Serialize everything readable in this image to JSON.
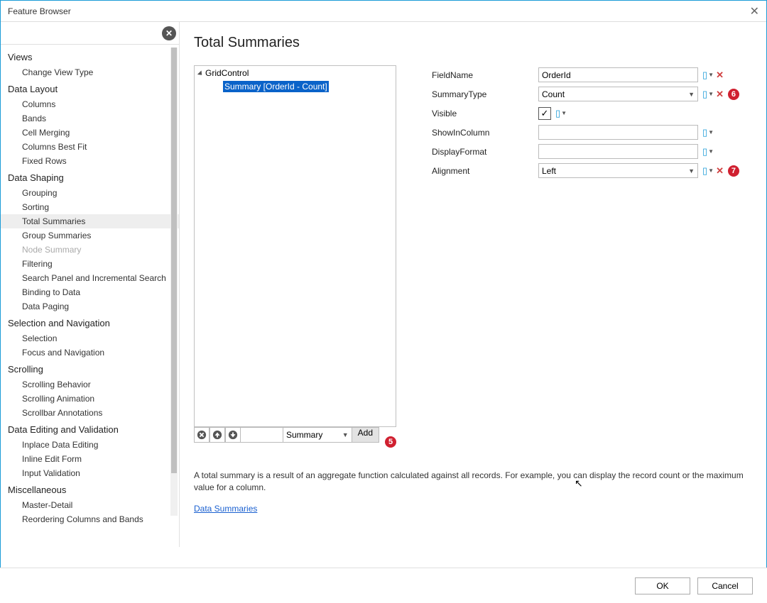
{
  "window": {
    "title": "Feature Browser"
  },
  "sidebar": {
    "categories": [
      {
        "label": "Views",
        "items": [
          {
            "label": "Change View Type"
          }
        ]
      },
      {
        "label": "Data Layout",
        "items": [
          {
            "label": "Columns"
          },
          {
            "label": "Bands"
          },
          {
            "label": "Cell Merging"
          },
          {
            "label": "Columns Best Fit"
          },
          {
            "label": "Fixed Rows"
          }
        ]
      },
      {
        "label": "Data Shaping",
        "items": [
          {
            "label": "Grouping"
          },
          {
            "label": "Sorting"
          },
          {
            "label": "Total Summaries",
            "selected": true
          },
          {
            "label": "Group Summaries"
          },
          {
            "label": "Node Summary",
            "disabled": true
          },
          {
            "label": "Filtering"
          },
          {
            "label": "Search Panel and Incremental Search"
          },
          {
            "label": "Binding to Data"
          },
          {
            "label": "Data Paging"
          }
        ]
      },
      {
        "label": "Selection and Navigation",
        "items": [
          {
            "label": "Selection"
          },
          {
            "label": "Focus and Navigation"
          }
        ]
      },
      {
        "label": "Scrolling",
        "items": [
          {
            "label": "Scrolling Behavior"
          },
          {
            "label": "Scrolling Animation"
          },
          {
            "label": "Scrollbar Annotations"
          }
        ]
      },
      {
        "label": "Data Editing and Validation",
        "items": [
          {
            "label": "Inplace Data Editing"
          },
          {
            "label": "Inline Edit Form"
          },
          {
            "label": "Input Validation"
          }
        ]
      },
      {
        "label": "Miscellaneous",
        "items": [
          {
            "label": "Master-Detail"
          },
          {
            "label": "Reordering Columns and Bands"
          }
        ]
      }
    ]
  },
  "page": {
    "title": "Total Summaries",
    "tree": {
      "root": "GridControl",
      "child": "Summary [OrderId - Count]"
    },
    "toolbar": {
      "type_label": "Summary",
      "add_label": "Add"
    },
    "description": "A total summary is a result of an aggregate function calculated against all records. For example, you can display the record count or the maximum value for a column.",
    "link": "Data Summaries"
  },
  "props": {
    "rows": [
      {
        "label": "FieldName",
        "kind": "text",
        "value": "OrderId",
        "has_x": true,
        "annot": ""
      },
      {
        "label": "SummaryType",
        "kind": "select",
        "value": "Count",
        "has_x": true,
        "annot": "6"
      },
      {
        "label": "Visible",
        "kind": "check",
        "value": "✓",
        "has_x": false,
        "annot": ""
      },
      {
        "label": "ShowInColumn",
        "kind": "text",
        "value": "",
        "has_x": false,
        "annot": ""
      },
      {
        "label": "DisplayFormat",
        "kind": "text",
        "value": "",
        "has_x": false,
        "annot": ""
      },
      {
        "label": "Alignment",
        "kind": "select",
        "value": "Left",
        "has_x": true,
        "annot": "7"
      }
    ]
  },
  "annotations": {
    "add_button": "5"
  },
  "footer": {
    "ok": "OK",
    "cancel": "Cancel"
  }
}
